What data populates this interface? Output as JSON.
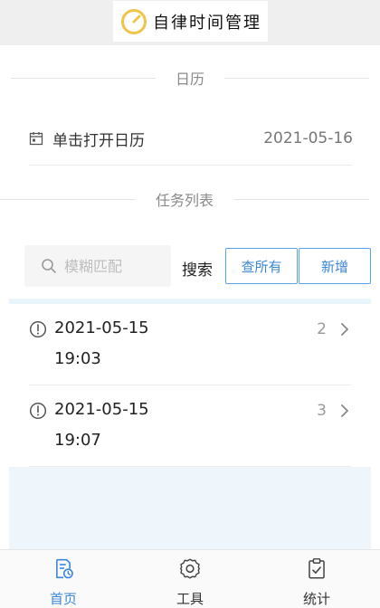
{
  "app": {
    "title": "自律时间管理"
  },
  "sections": {
    "calendar_title": "日历",
    "tasks_title": "任务列表"
  },
  "calendar": {
    "label": "单击打开日历",
    "date": "2021-05-16"
  },
  "search": {
    "placeholder": "模糊匹配",
    "value": "",
    "label": "搜索"
  },
  "buttons": {
    "view_all": "查所有",
    "add_new": "新增"
  },
  "tasks": [
    {
      "date": "2021-05-15",
      "time": "19:03",
      "count": "2"
    },
    {
      "date": "2021-05-15",
      "time": "19:07",
      "count": "3"
    }
  ],
  "tabbar": {
    "items": [
      {
        "label": "首页",
        "icon": "home-doc-clock-icon",
        "active": true
      },
      {
        "label": "工具",
        "icon": "gear-icon",
        "active": false
      },
      {
        "label": "统计",
        "icon": "clipboard-check-icon",
        "active": false
      }
    ]
  },
  "colors": {
    "accent": "#3c87d8",
    "logo": "#f0c34a"
  }
}
